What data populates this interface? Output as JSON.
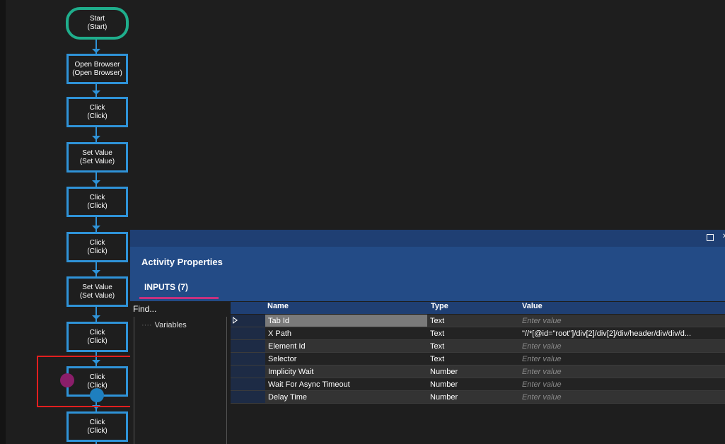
{
  "flow": {
    "nodes": [
      {
        "title": "Start",
        "subtitle": "(Start)"
      },
      {
        "title": "Open Browser",
        "subtitle": "(Open Browser)"
      },
      {
        "title": "Click",
        "subtitle": "(Click)"
      },
      {
        "title": "Set Value",
        "subtitle": "(Set Value)"
      },
      {
        "title": "Click",
        "subtitle": "(Click)"
      },
      {
        "title": "Click",
        "subtitle": "(Click)"
      },
      {
        "title": "Set Value",
        "subtitle": "(Set Value)"
      },
      {
        "title": "Click",
        "subtitle": "(Click)"
      },
      {
        "title": "Click",
        "subtitle": "(Click)"
      },
      {
        "title": "Click",
        "subtitle": "(Click)"
      }
    ]
  },
  "panel": {
    "title": "Activity Properties",
    "tab_label": "INPUTS (7)",
    "find_label": "Find...",
    "tree_item": "Variables",
    "columns": {
      "name": "Name",
      "type": "Type",
      "value": "Value"
    },
    "rows": [
      {
        "name": "Tab Id",
        "type": "Text",
        "value": "Enter value",
        "is_placeholder": true
      },
      {
        "name": "X Path",
        "type": "Text",
        "value": "\"//*[@id=\"root\"]/div[2]/div[2]/div/header/div/div/d...",
        "is_placeholder": false
      },
      {
        "name": "Element Id",
        "type": "Text",
        "value": "Enter value",
        "is_placeholder": true
      },
      {
        "name": "Selector",
        "type": "Text",
        "value": "Enter value",
        "is_placeholder": true
      },
      {
        "name": "Implicity Wait",
        "type": "Number",
        "value": "Enter value",
        "is_placeholder": true
      },
      {
        "name": "Wait For Async Timeout",
        "type": "Number",
        "value": "Enter value",
        "is_placeholder": true
      },
      {
        "name": "Delay Time",
        "type": "Number",
        "value": "Enter value",
        "is_placeholder": true
      }
    ]
  },
  "colors": {
    "start_border": "#1fae8c",
    "node_border": "#2f93d8",
    "highlight": "#e21f1f",
    "panel_header": "#234b86",
    "tab_underline": "#c5327f"
  }
}
